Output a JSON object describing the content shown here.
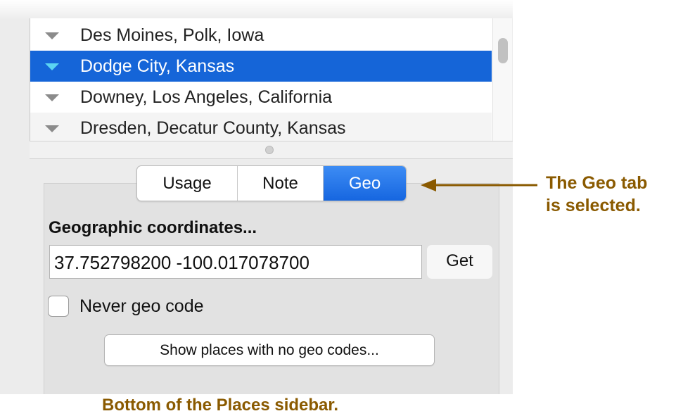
{
  "places_list": {
    "rows": [
      {
        "label": "Des Moines, Polk, Iowa"
      },
      {
        "label": "Dodge City, Kansas"
      },
      {
        "label": "Downey, Los Angeles, California"
      },
      {
        "label": "Dresden, Decatur County, Kansas"
      }
    ],
    "selected_index": 1
  },
  "tabs": {
    "items": [
      {
        "label": "Usage"
      },
      {
        "label": "Note"
      },
      {
        "label": "Geo"
      }
    ],
    "active": "Geo"
  },
  "geo_panel": {
    "heading": "Geographic coordinates...",
    "coordinates_value": "37.752798200 -100.017078700",
    "get_button": "Get",
    "never_geo_code_label": "Never geo code",
    "never_geo_code_checked": false,
    "show_places_button": "Show places with no geo codes..."
  },
  "annotations": {
    "callout_line1": "The Geo tab",
    "callout_line2": "is selected.",
    "caption": "Bottom of the Places sidebar."
  },
  "colors": {
    "selection": "#1565d8",
    "active_tab": "#1a6fe6",
    "annotation": "#8a5a00"
  }
}
